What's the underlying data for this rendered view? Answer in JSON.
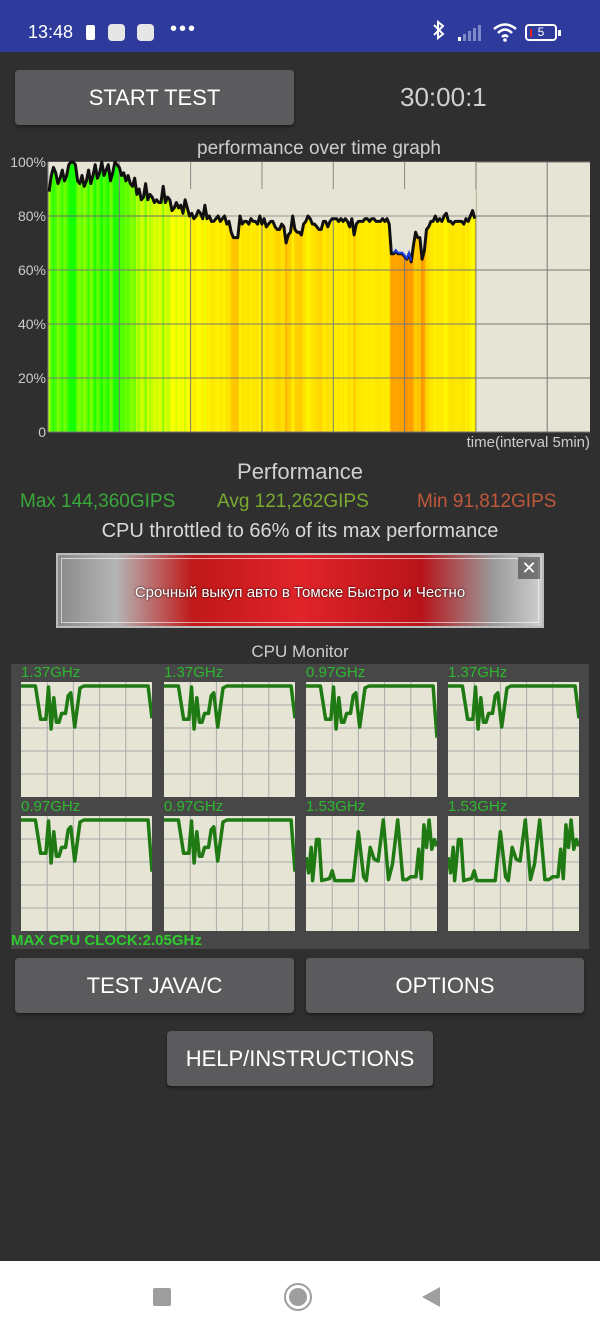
{
  "status_bar": {
    "time": "13:48",
    "battery_level": "5",
    "icons": [
      "battery-small-icon",
      "app-icon",
      "app-icon",
      "more-dots-icon",
      "bluetooth-icon",
      "signal-icon",
      "wifi-icon",
      "battery-icon"
    ],
    "more": "•••",
    "bluetooth": "✱",
    "wifi": "◔"
  },
  "controls": {
    "start_test": "START TEST",
    "timer": "30:00:1",
    "test_java_c": "TEST JAVA/C",
    "options": "OPTIONS",
    "help": "HELP/INSTRUCTIONS"
  },
  "chart_data": {
    "type": "area",
    "title": "performance over time graph",
    "xlabel": "time(interval 5min)",
    "ylabel": "",
    "ylim": [
      0,
      100
    ],
    "y_ticks": [
      "0",
      "20%",
      "40%",
      "60%",
      "80%",
      "100%"
    ],
    "x_interval_minutes": 5,
    "x_range_minutes": [
      0,
      38
    ],
    "data_end_minutes": 30,
    "grid": true,
    "series": [
      {
        "name": "performance",
        "values": [
          89,
          95,
          98,
          96,
          92,
          94,
          97,
          93,
          95,
          99,
          100,
          100,
          99,
          93,
          92,
          95,
          91,
          93,
          97,
          92,
          95,
          99,
          94,
          96,
          100,
          95,
          97,
          99,
          93,
          96,
          100,
          99,
          98,
          95,
          96,
          93,
          95,
          92,
          91,
          94,
          88,
          90,
          86,
          87,
          92,
          86,
          88,
          87,
          85,
          86,
          85,
          85,
          91,
          85,
          87,
          86,
          82,
          83,
          85,
          83,
          84,
          81,
          86,
          83,
          80,
          81,
          79,
          80,
          82,
          81,
          79,
          84,
          79,
          80,
          78,
          78,
          79,
          80,
          78,
          79,
          80,
          77,
          78,
          74,
          72,
          72,
          72,
          80,
          77,
          78,
          78,
          77,
          79,
          78,
          78,
          77,
          80,
          77,
          79,
          76,
          77,
          78,
          78,
          76,
          75,
          75,
          77,
          76,
          70,
          73,
          74,
          80,
          75,
          74,
          74,
          73,
          77,
          78,
          80,
          79,
          77,
          77,
          76,
          75,
          75,
          78,
          78,
          76,
          78,
          79,
          79,
          79,
          78,
          79,
          78,
          79,
          78,
          76,
          79,
          73,
          77,
          78,
          78,
          78,
          79,
          79,
          78,
          79,
          79,
          78,
          78,
          78,
          79,
          78,
          79,
          77,
          66,
          66,
          67,
          66,
          66,
          66,
          65,
          64,
          66,
          63,
          69,
          74,
          72,
          72,
          64,
          67,
          75,
          76,
          78,
          78,
          80,
          78,
          79,
          78,
          80,
          81,
          78,
          78,
          77,
          78,
          78,
          78,
          78,
          77,
          79,
          78,
          80,
          82,
          79
        ]
      }
    ],
    "bar_colors": "green (high) to yellow to orange (low)",
    "min_marker_color": "#1f3fe0"
  },
  "performance": {
    "heading": "Performance",
    "max": "Max 144,360GIPS",
    "avg": "Avg 121,262GIPS",
    "min": "Min 91,812GIPS",
    "throttle": "CPU throttled to 66% of its max performance",
    "colors": {
      "max": "#3aa83a",
      "avg": "#7aaa30",
      "min": "#c0583a"
    }
  },
  "ad": {
    "text": "Срочный выкуп авто в Томске Быстро и Честно",
    "close": "✕"
  },
  "cpu_monitor": {
    "title": "CPU Monitor",
    "max_clock": "MAX CPU CLOCK:2.05GHz",
    "cores": [
      {
        "freq": "1.37GHz",
        "pattern": "a",
        "end": 0.67
      },
      {
        "freq": "1.37GHz",
        "pattern": "a",
        "end": 0.67
      },
      {
        "freq": "0.97GHz",
        "pattern": "a",
        "end": 0.47
      },
      {
        "freq": "1.37GHz",
        "pattern": "a",
        "end": 0.67
      },
      {
        "freq": "0.97GHz",
        "pattern": "a",
        "end": 0.47
      },
      {
        "freq": "0.97GHz",
        "pattern": "a",
        "end": 0.47
      },
      {
        "freq": "1.53GHz",
        "pattern": "b",
        "end": 0.75
      },
      {
        "freq": "1.53GHz",
        "pattern": "b",
        "end": 0.75
      }
    ]
  },
  "nav": {
    "recents": "recents-button",
    "home": "home-button",
    "back": "back-button"
  }
}
